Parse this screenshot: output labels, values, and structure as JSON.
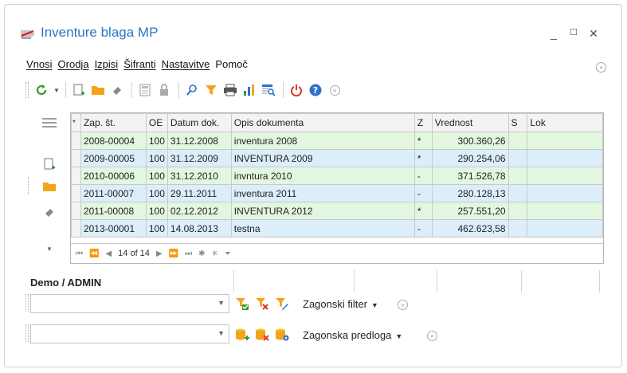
{
  "window": {
    "title": "Inventure blaga MP",
    "controls": {
      "minimize": "_",
      "maximize": "☐",
      "close": "✕"
    }
  },
  "menu": {
    "items": [
      "Vnosi",
      "Orodja",
      "Izpisi",
      "Šifranti",
      "Nastavitve",
      "Pomoč"
    ]
  },
  "toolbar": {
    "icons": [
      "refresh-icon",
      "new-icon",
      "open-folder-icon",
      "eraser-icon",
      "calculator-icon",
      "lock-icon",
      "search-icon",
      "filter-icon",
      "print-icon",
      "chart-icon",
      "report-search-icon",
      "power-icon",
      "help-icon",
      "more-icon"
    ]
  },
  "side_panel": {
    "icons": [
      "hamburger-icon",
      "new-icon",
      "open-folder-icon",
      "eraser-icon",
      "chevron-down-icon"
    ]
  },
  "grid": {
    "columns": [
      "*",
      "Zap. št.",
      "OE",
      "Datum dok.",
      "Opis dokumenta",
      "Z",
      "Vrednost",
      "S",
      "Lok"
    ],
    "rows": [
      {
        "zap": "2008-00004",
        "oe": "100",
        "datum": "31.12.2008",
        "opis": "inventura 2008",
        "z": "*",
        "vrednost": "300.360,26",
        "s": "",
        "lok": ""
      },
      {
        "zap": "2009-00005",
        "oe": "100",
        "datum": "31.12.2009",
        "opis": "INVENTURA 2009",
        "z": "*",
        "vrednost": "290.254,06",
        "s": "",
        "lok": ""
      },
      {
        "zap": "2010-00006",
        "oe": "100",
        "datum": "31.12.2010",
        "opis": "invntura 2010",
        "z": "-",
        "vrednost": "371.526,78",
        "s": "",
        "lok": ""
      },
      {
        "zap": "2011-00007",
        "oe": "100",
        "datum": "29.11.2011",
        "opis": "inventura 2011",
        "z": "-",
        "vrednost": "280.128,13",
        "s": "",
        "lok": ""
      },
      {
        "zap": "2011-00008",
        "oe": "100",
        "datum": "02.12.2012",
        "opis": "INVENTURA 2012",
        "z": "*",
        "vrednost": "257.551,20",
        "s": "",
        "lok": ""
      },
      {
        "zap": "2013-00001",
        "oe": "100",
        "datum": "14.08.2013",
        "opis": "testna",
        "z": "-",
        "vrednost": "462.623,58",
        "s": "",
        "lok": ""
      }
    ],
    "navigator": {
      "position": "14 of 14"
    }
  },
  "status": {
    "text": "Demo / ADMIN"
  },
  "filter": {
    "combo_value": "",
    "label": "Zagonski filter"
  },
  "template": {
    "combo_value": "",
    "label": "Zagonska predloga"
  },
  "colors": {
    "title": "#2b78c5",
    "row_green": "#e3f6df",
    "row_blue": "#dbeefa",
    "accent_orange": "#f2a51a",
    "refresh_green": "#3a9a2f",
    "power_red": "#e0322a",
    "help_blue": "#2f6fc9"
  }
}
